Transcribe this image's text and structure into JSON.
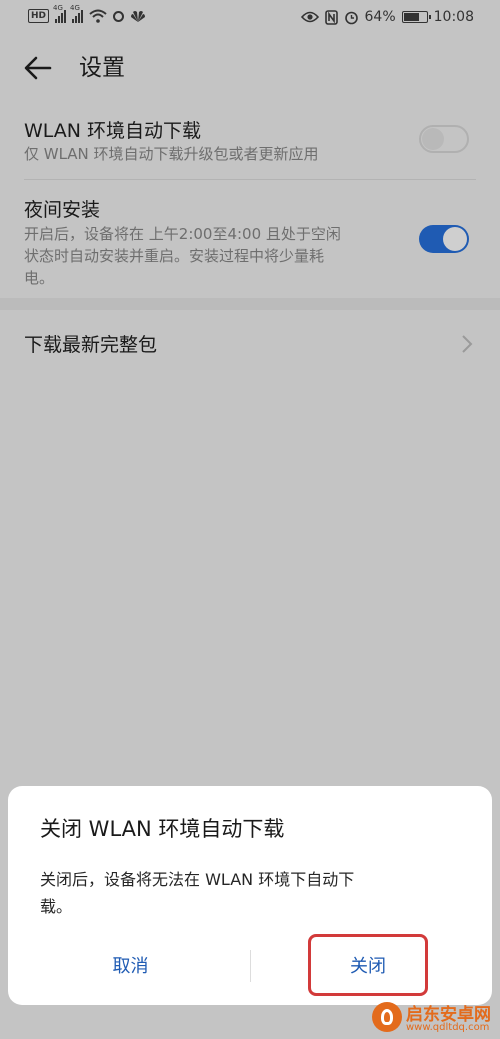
{
  "status_bar": {
    "hd": "HD",
    "sig1": "4G",
    "sig2": "4G",
    "battery": "64%",
    "time": "10:08"
  },
  "header": {
    "title": "设置"
  },
  "settings": {
    "wlan": {
      "title": "WLAN 环境自动下载",
      "subtitle": "仅 WLAN 环境自动下载升级包或者更新应用",
      "enabled": false
    },
    "night": {
      "title": "夜间安装",
      "subtitle_line1": "开启后，设备将在 上午2:00至4:00 且处于空闲",
      "subtitle_line2": "状态时自动安装并重启。安装过程中将少量耗",
      "subtitle_line3": "电。",
      "enabled": true
    },
    "download": {
      "title": "下载最新完整包"
    }
  },
  "dialog": {
    "title": "关闭 WLAN 环境自动下载",
    "message_line1": "关闭后，设备将无法在 WLAN 环境下自动下",
    "message_line2": "载。",
    "cancel_label": "取消",
    "close_label": "关闭"
  },
  "watermark": {
    "name": "启东安卓网",
    "url": "www.qdltdq.com"
  },
  "colors": {
    "accent": "#1f5bb3",
    "highlight": "#d23a3a",
    "watermark": "#e36b1c"
  },
  "icons": [
    "back-arrow-icon",
    "chevron-right-icon",
    "wifi-icon",
    "eye-icon",
    "nfc-icon",
    "alarm-icon",
    "battery-icon"
  ]
}
